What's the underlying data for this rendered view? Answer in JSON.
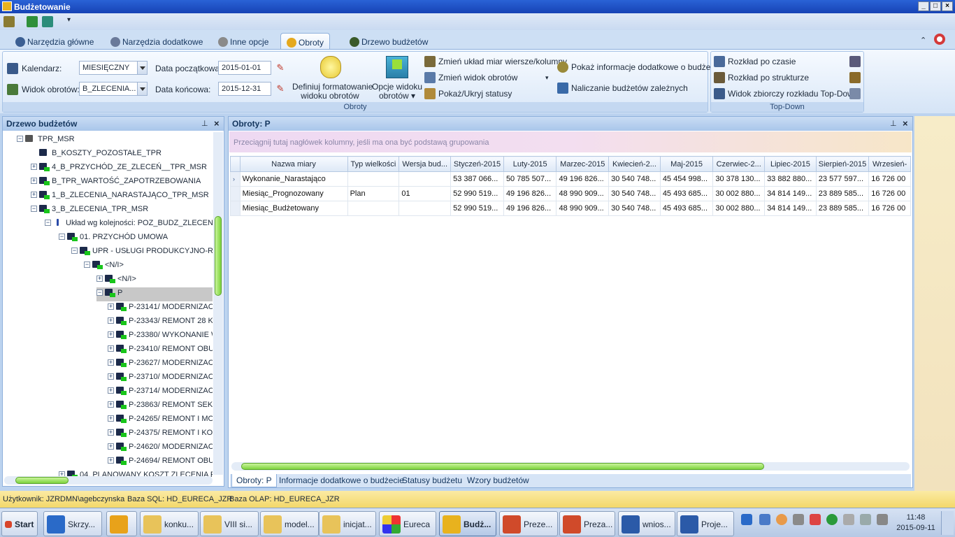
{
  "window": {
    "title": "Budżetowanie"
  },
  "ribbon": {
    "tabs": [
      "Narzędzia główne",
      "Narzędzia dodatkowe",
      "Inne opcje",
      "Obroty",
      "Drzewo budżetów"
    ],
    "active_tab": "Obroty",
    "calendar_label": "Kalendarz:",
    "calendar_value": "MIESIĘCZNY",
    "view_label": "Widok obrotów:",
    "view_value": "B_ZLECENIA...",
    "start_label": "Data początkowa:",
    "start_value": "2015-01-01",
    "end_label": "Data końcowa:",
    "end_value": "2015-12-31",
    "define_format_line1": "Definiuj formatowanie",
    "define_format_line2": "widoku obrotów",
    "view_options_line1": "Opcje widoku",
    "view_options_line2": "obrotów",
    "change_layout": "Zmień układ miar wiersze/kolumny",
    "change_view": "Zmień widok obrotów",
    "toggle_statuses": "Pokaż/Ukryj statusy",
    "show_info": "Pokaż informacje dodatkowe o budżecie",
    "dependent_budgets": "Naliczanie budżetów zależnych",
    "group_obroty": "Obroty",
    "time_distribution": "Rozkład po czasie",
    "structure_distribution": "Rozkład po strukturze",
    "topdown_summary": "Widok zbiorczy rozkładu Top-Down",
    "group_topdown": "Top-Down"
  },
  "tree": {
    "title": "Drzewo budżetów",
    "rows": [
      {
        "label": "TPR_MSR"
      },
      {
        "label": "B_KOSZTY_POZOSTAŁE_TPR"
      },
      {
        "label": "4_B_PRZYCHÓD_ZE_ZLECEŃ__TPR_MSR"
      },
      {
        "label": "B_TPR_WARTOŚĆ_ZAPOTRZEBOWANIA"
      },
      {
        "label": "1_B_ZLECENIA_NARASTAJĄCO_TPR_MSR"
      },
      {
        "label": "3_B_ZLECENIA_TPR_MSR"
      },
      {
        "label": "Układ wg kolejności: POZ_BUDZ_ZLECENIA"
      },
      {
        "label": "01. PRZYCHÓD UMOWA"
      },
      {
        "label": "UPR - USŁUGI PRODUKCYJNO-REM"
      },
      {
        "label": "<N/I>"
      },
      {
        "label": "<N/I>"
      },
      {
        "label": "P"
      },
      {
        "label": "P-23141/ MODERNIZAC."
      },
      {
        "label": "P-23343/ REMONT 28 KI"
      },
      {
        "label": "P-23380/ WYKONANIE W"
      },
      {
        "label": "P-23410/ REMONT OBUD"
      },
      {
        "label": "P-23627/ MODERNIZAC."
      },
      {
        "label": "P-23710/ MODERNIZAC."
      },
      {
        "label": "P-23714/ MODERNIZAC."
      },
      {
        "label": "P-23863/ REMONT SEKC"
      },
      {
        "label": "P-24265/ REMONT I MO"
      },
      {
        "label": "P-24375/ REMONT I KON"
      },
      {
        "label": "P-24620/ MODERNIZAC."
      },
      {
        "label": "P-24694/ REMONT OBUD"
      },
      {
        "label": "04. PLANOWANY KOSZT ZLECENIA REZ"
      }
    ]
  },
  "main": {
    "title": "Obroty: P",
    "group_hint": "Przeciągnij tutaj nagłówek kolumny, jeśli ma ona być podstawą grupowania",
    "columns": [
      "Nazwa miary",
      "Typ wielkości",
      "Wersja bud...",
      "Styczeń-2015",
      "Luty-2015",
      "Marzec-2015",
      "Kwiecień-2...",
      "Maj-2015",
      "Czerwiec-2...",
      "Lipiec-2015",
      "Sierpień-2015",
      "Wrzesień-"
    ],
    "rows": [
      [
        "Wykonanie_Narastająco",
        "",
        "",
        "53 387 066...",
        "50 785 507...",
        "49 196 826...",
        "30 540 748...",
        "45 454 998...",
        "30 378 130...",
        "33 882 880...",
        "23 577 597...",
        "16 726 00"
      ],
      [
        "Miesiąc_Prognozowany",
        "Plan",
        "01",
        "52 990 519...",
        "49 196 826...",
        "48 990 909...",
        "30 540 748...",
        "45 493 685...",
        "30 002 880...",
        "34 814 149...",
        "23 889 585...",
        "16 726 00"
      ],
      [
        "Miesiąc_Budżetowany",
        "",
        "",
        "52 990 519...",
        "49 196 826...",
        "48 990 909...",
        "30 540 748...",
        "45 493 685...",
        "30 002 880...",
        "34 814 149...",
        "23 889 585...",
        "16 726 00"
      ]
    ],
    "bottom_tabs": [
      "Obroty: P",
      "Informacje dodatkowe o budżecie",
      "Statusy budżetu",
      "Wzory budżetów"
    ]
  },
  "status": {
    "user": "Użytkownik: JZRDMN\\agebczynska",
    "sql": "Baza SQL: HD_EURECA_JZR",
    "olap": "Baza OLAP: HD_EURECA_JZR"
  },
  "taskbar": {
    "start": "Start",
    "items": [
      "Skrzy...",
      "",
      "konku...",
      "VIII si...",
      "model...",
      "inicjat...",
      "Eureca",
      "Budż...",
      "Preze...",
      "Preza...",
      "wnios...",
      "Proje..."
    ],
    "time": "11:48",
    "date": "2015-09-11"
  }
}
